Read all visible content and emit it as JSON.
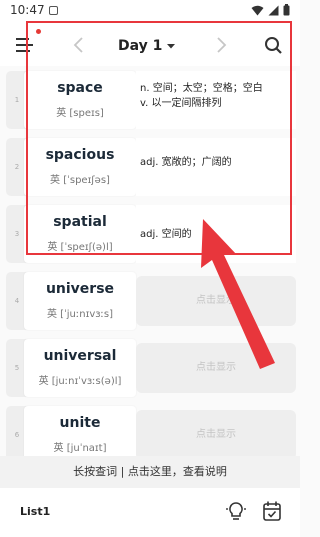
{
  "status_bar": {
    "time": "10:47"
  },
  "header": {
    "title": "Day 1"
  },
  "words": [
    {
      "index": "1",
      "word": "space",
      "phonetic": "英 [speɪs]",
      "meaning": [
        "n. 空间；太空；空格；空白",
        "v. 以一定间隔排列"
      ],
      "revealed": true
    },
    {
      "index": "2",
      "word": "spacious",
      "phonetic": "英 [ˈspeɪʃəs]",
      "meaning": [
        "adj. 宽敞的；广阔的"
      ],
      "revealed": true
    },
    {
      "index": "3",
      "word": "spatial",
      "phonetic": "英 [ˈspeɪʃ(ə)l]",
      "meaning": [
        "adj. 空间的"
      ],
      "revealed": true
    },
    {
      "index": "4",
      "word": "universe",
      "phonetic": "英 [ˈjuːnɪvɜːs]",
      "reveal_label": "点击显示",
      "revealed": false
    },
    {
      "index": "5",
      "word": "universal",
      "phonetic": "英 [juːnɪˈvɜːs(ə)l]",
      "reveal_label": "点击显示",
      "revealed": false
    },
    {
      "index": "6",
      "word": "unite",
      "phonetic": "英 [juˈnaɪt]",
      "reveal_label": "点击显示",
      "revealed": false
    }
  ],
  "hint": "长按查词 | 点击这里，查看说明",
  "bottom_bar": {
    "list_label": "List1"
  },
  "colors": {
    "highlight": "#e8363c",
    "accent_dot": "#e53935"
  },
  "icons": [
    "menu-icon",
    "chevron-left-icon",
    "caret-down-icon",
    "chevron-right-icon",
    "search-icon",
    "lightbulb-icon",
    "calendar-check-icon",
    "wifi-icon",
    "signal-icon",
    "battery-icon"
  ]
}
